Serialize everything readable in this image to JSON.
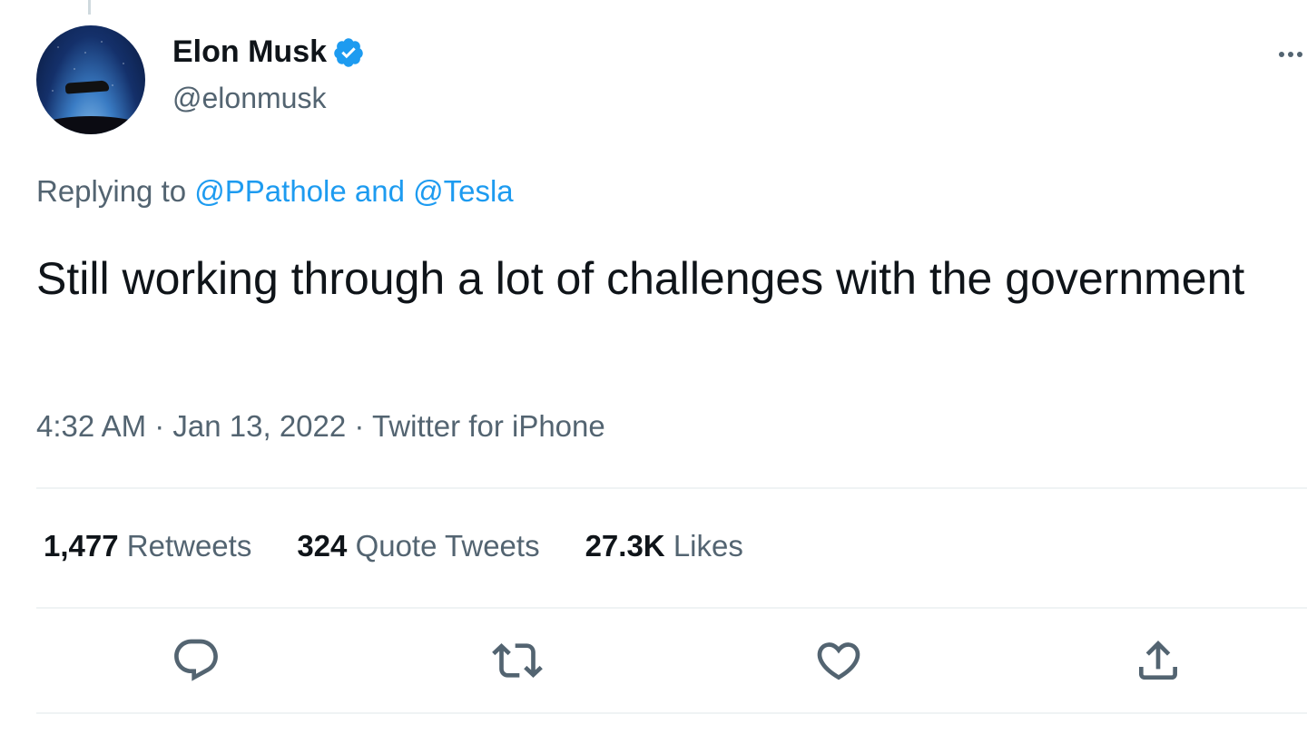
{
  "tweet": {
    "author": {
      "display_name": "Elon Musk",
      "handle": "@elonmusk",
      "verified": true
    },
    "replying_to": {
      "prefix": "Replying to",
      "mentions": "@PPathole and @Tesla"
    },
    "text": "Still working through a lot of challenges with the government",
    "meta": "4:32 AM · Jan 13, 2022 · Twitter for iPhone",
    "stats": [
      {
        "count": "1,477",
        "label": "Retweets"
      },
      {
        "count": "324",
        "label": "Quote Tweets"
      },
      {
        "count": "27.3K",
        "label": "Likes"
      }
    ],
    "actions": [
      "reply-icon",
      "retweet-icon",
      "like-icon",
      "share-icon"
    ]
  },
  "colors": {
    "accent": "#1d9bf0",
    "secondary_text": "#536471",
    "primary_text": "#0f1419",
    "divider": "#eff3f4"
  }
}
